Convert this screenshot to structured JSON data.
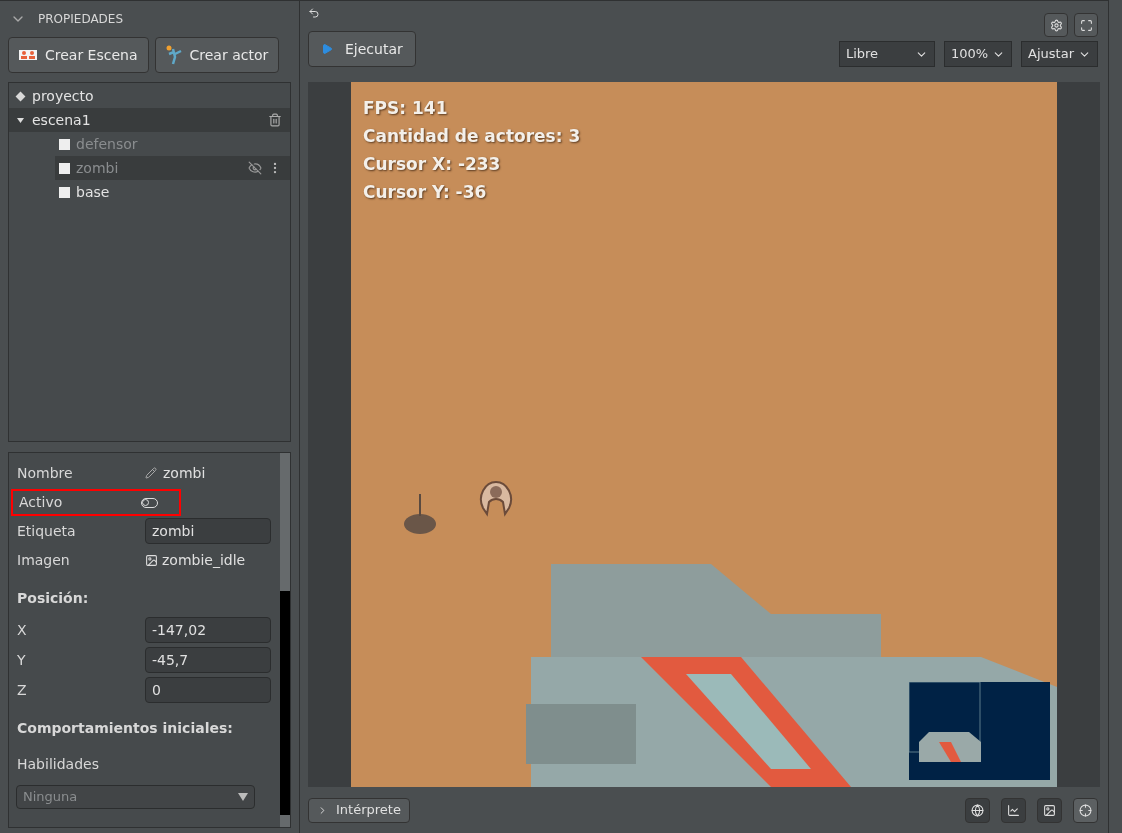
{
  "panel": {
    "title": "PROPIEDADES",
    "expanded": true
  },
  "buttons": [
    {
      "kind": "scene",
      "label": "Crear Escena"
    },
    {
      "kind": "actor",
      "label": "Crear actor"
    }
  ],
  "tree": [
    {
      "kind": "project",
      "label": "proyecto",
      "selected": false
    },
    {
      "kind": "scene",
      "label": "escena1",
      "selected": true,
      "expanded": true,
      "children": [
        {
          "kind": "actor",
          "label": "defensor",
          "active": false,
          "selected": false,
          "hidden": false
        },
        {
          "kind": "actor",
          "label": "zombi",
          "active": false,
          "selected": true,
          "hidden": true
        },
        {
          "kind": "actor",
          "label": "base",
          "active": true,
          "selected": false,
          "hidden": false
        }
      ]
    }
  ],
  "properties": [
    {
      "kind": "name",
      "label": "Nombre",
      "value": "zombi"
    },
    {
      "kind": "toggle",
      "label": "Activo",
      "on": false,
      "highlighted": true
    },
    {
      "kind": "input",
      "label": "Etiqueta",
      "value": "zombi"
    },
    {
      "kind": "image",
      "label": "Imagen",
      "value": "zombie_idle"
    },
    {
      "kind": "heading",
      "label": "Posición:"
    },
    {
      "kind": "input",
      "label": "X",
      "value": "-147,02"
    },
    {
      "kind": "input",
      "label": "Y",
      "value": "-45,7"
    },
    {
      "kind": "input",
      "label": "Z",
      "value": "0"
    },
    {
      "kind": "heading",
      "label": "Comportamientos iniciales:"
    },
    {
      "kind": "label",
      "label": "Habilidades"
    },
    {
      "kind": "select",
      "value": "Ninguna",
      "disabled": true
    }
  ],
  "toolbar": {
    "run_label": "Ejecutar",
    "selects": [
      "Libre",
      "100%",
      "Ajustar"
    ]
  },
  "hud": [
    "FPS: 141",
    "Cantidad de actores: 3",
    "Cursor X: -233",
    "Cursor Y: -36"
  ],
  "bottom": {
    "console_label": "Intérprete",
    "tools": [
      {
        "kind": "globe",
        "selected": false
      },
      {
        "kind": "chart",
        "selected": false
      },
      {
        "kind": "image",
        "selected": false
      },
      {
        "kind": "target",
        "selected": true
      }
    ]
  }
}
